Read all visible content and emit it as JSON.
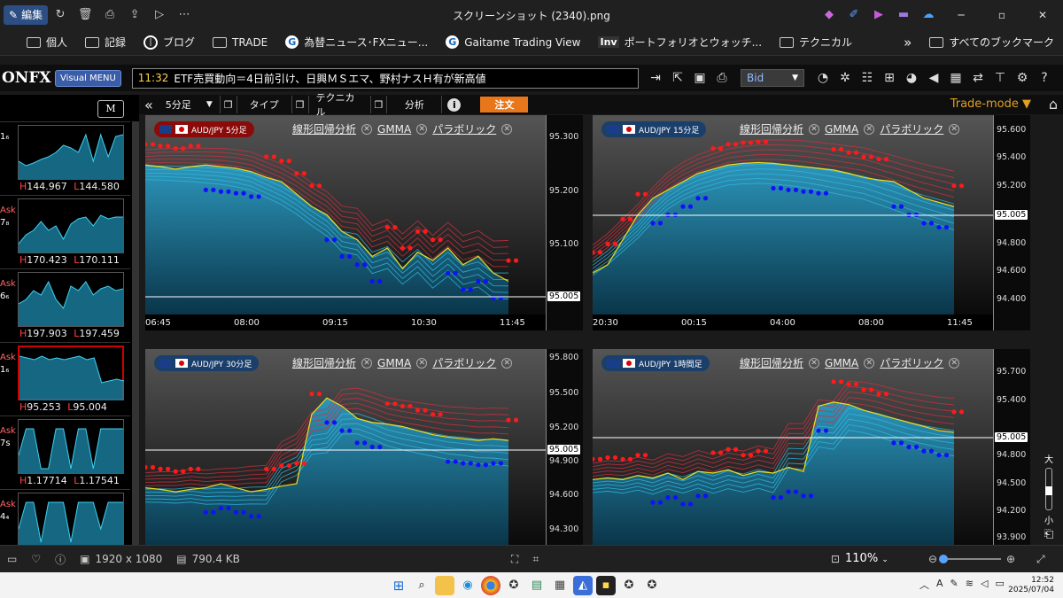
{
  "viewer": {
    "edit_label": "編集",
    "title": "スクリーンショット (2340).png",
    "image_size": "1920 x 1080",
    "file_size": "790.4 KB",
    "zoom": "110%"
  },
  "bookmarks": {
    "items": [
      {
        "label": "個人",
        "icon": "folder-icon"
      },
      {
        "label": "記録",
        "icon": "folder-icon"
      },
      {
        "label": "ブログ",
        "icon": "circle-bookmark-icon"
      },
      {
        "label": "TRADE",
        "icon": "folder-icon"
      },
      {
        "label": "為替ニュース･FXニュー...",
        "icon": "gaitame-icon"
      },
      {
        "label": "Gaitame Trading View",
        "icon": "gaitame-icon"
      },
      {
        "label": "ポートフォリオとウォッチ...",
        "icon": "inv-icon"
      },
      {
        "label": "テクニカル",
        "icon": "folder-icon"
      }
    ],
    "all_label": "すべてのブックマーク"
  },
  "app": {
    "logo": "ONFX",
    "visual_menu": "Visual MENU",
    "ticker_time": "11:32",
    "ticker_text": "ETF売買動向＝4日前引け、日興ＭＳエマ、野村ナスＨ有が新高値",
    "bid_select": "Bid",
    "m_button": "M"
  },
  "toolbar": {
    "timeframe": "5分足",
    "type_label": "タイプ",
    "technical_label": "テクニカル",
    "analysis_label": "分析",
    "order_label": "注文",
    "trade_mode": "Trade-mode"
  },
  "sidebar": {
    "rows": [
      {
        "left_a": "",
        "left_b": "1₆",
        "price_l": "144.967",
        "price_r": "144.580",
        "selected": false
      },
      {
        "left_a": "Ask",
        "left_b": "7₈",
        "price_l": "170.423",
        "price_r": "170.111",
        "selected": false
      },
      {
        "left_a": "Ask",
        "left_b": "6₆",
        "price_l": "197.903",
        "price_r": "197.459",
        "selected": false
      },
      {
        "left_a": "Ask",
        "left_b": "1₆",
        "price_l": "95.253",
        "price_r": "95.004",
        "selected": true
      },
      {
        "left_a": "Ask",
        "left_b": "7s",
        "price_l": "1.17714",
        "price_r": "1.17541",
        "selected": false
      },
      {
        "left_a": "Ask",
        "left_b": "4₄",
        "price_l": "",
        "price_r": "",
        "selected": false
      }
    ]
  },
  "indicators": {
    "linreg": "線形回帰分析",
    "gmma": "GMMA",
    "parabolic": "パラボリック"
  },
  "panels": [
    {
      "tag": "AUD/JPY 5分足",
      "tag_color": "#8b0a0a",
      "yticks": [
        "95.300",
        "95.200",
        "95.100"
      ],
      "current": "95.005",
      "xticks": [
        "06:45",
        "08:00",
        "09:15",
        "10:30",
        "11:45"
      ]
    },
    {
      "tag": "AUD/JPY 15分足",
      "tag_color": "#1b3f6b",
      "yticks": [
        "95.600",
        "95.400",
        "95.200",
        "94.800",
        "94.600",
        "94.400"
      ],
      "current": "95.005",
      "xticks": [
        "20:30",
        "00:15",
        "04:00",
        "08:00",
        "11:45"
      ]
    },
    {
      "tag": "AUD/JPY 30分足",
      "tag_color": "#1b3f6b",
      "yticks": [
        "95.800",
        "95.500",
        "95.200",
        "94.900",
        "94.600",
        "94.300"
      ],
      "current": "95.005",
      "xticks": []
    },
    {
      "tag": "AUD/JPY 1時間足",
      "tag_color": "#1b3f6b",
      "yticks": [
        "95.700",
        "95.400",
        "94.800",
        "94.500",
        "94.200",
        "93.900"
      ],
      "current": "95.005",
      "xticks": []
    }
  ],
  "vzoom": {
    "top": "大",
    "bottom": "小"
  },
  "taskbar": {
    "time": "12:52",
    "date": "2025/07/04",
    "ime": "A"
  },
  "colors": {
    "accent_orange": "#e8761a",
    "parabolic_red": "#ff1a1a",
    "parabolic_blue": "#1010ff",
    "area_fill": "#1f8fb0"
  }
}
